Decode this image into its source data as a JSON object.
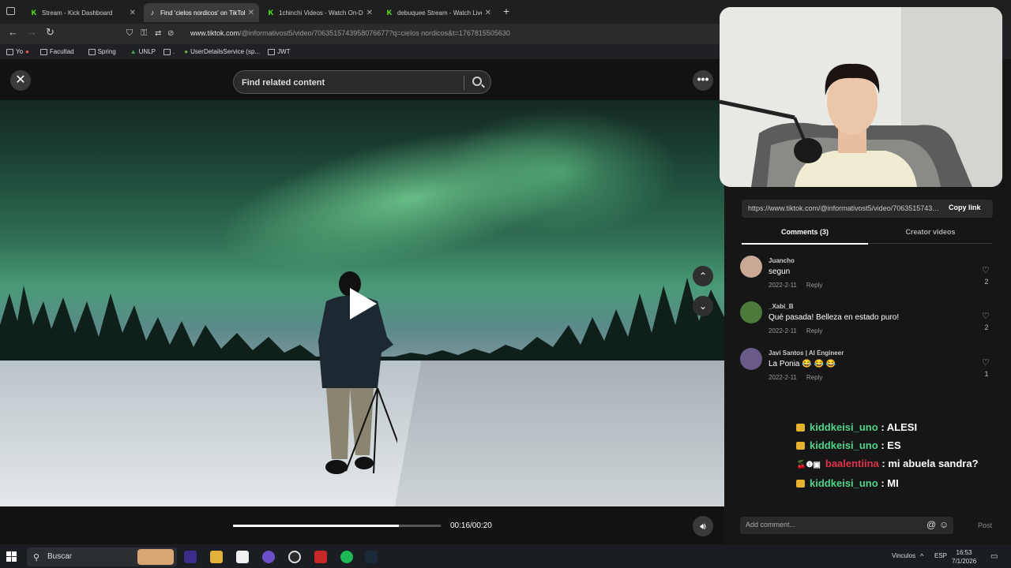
{
  "browser": {
    "tabs": [
      {
        "title": "Stream - Kick Dashboard",
        "favicon": "kick-icon"
      },
      {
        "title": "Find 'cielos nordicos' on TikTok",
        "favicon": "tiktok-icon"
      },
      {
        "title": "1chinchi Videos - Watch On-De",
        "favicon": "kick-icon"
      },
      {
        "title": "debuquee Stream - Watch Live",
        "favicon": "kick-icon"
      }
    ],
    "url_domain": "www.tiktok.com",
    "url_path": "/@informativost5/video/7063515743958076677?q=cielos nordicos&t=1767815505630",
    "bookmarks": [
      "Yo",
      "Facultad",
      "Spring",
      "UNLP",
      ".",
      "UserDetailsService (sp...",
      "JWT"
    ]
  },
  "player": {
    "search_placeholder": "Find related content",
    "progress": 0.8,
    "time": "00:16/00:20"
  },
  "side": {
    "link": "https://www.tiktok.com/@informativost5/video/7063515743958076677",
    "copy_label": "Copy link",
    "tab_comments": "Comments (3)",
    "tab_creator": "Creator videos",
    "comments": [
      {
        "user": "Juancho",
        "text": "segun",
        "date": "2022-2-11",
        "reply": "Reply",
        "likes": "2"
      },
      {
        "user": "_Xabi_B",
        "text": "Qué pasada! Belleza en estado puro!",
        "date": "2022-2-11",
        "reply": "Reply",
        "likes": "2"
      },
      {
        "user": "Javi Santos | AI Engineer",
        "text": "La Ponia 😂 😂 😂",
        "date": "2022-2-11",
        "reply": "Reply",
        "likes": "1"
      }
    ],
    "chat": [
      {
        "user": "kiddkeisi_uno",
        "msg": ": ALESI"
      },
      {
        "user": "kiddkeisi_uno",
        "msg": ": ES"
      },
      {
        "user": "baalentiina",
        "msg": ": mi abuela sandra?"
      },
      {
        "user": "kiddkeisi_uno",
        "msg": ": MI"
      }
    ],
    "add_comment": "Add comment...",
    "post": "Post"
  },
  "taskbar": {
    "search": "Buscar",
    "tray_links": "Vinculos",
    "lang": "ESP",
    "time": "16:53",
    "date": "7/1/2026"
  }
}
